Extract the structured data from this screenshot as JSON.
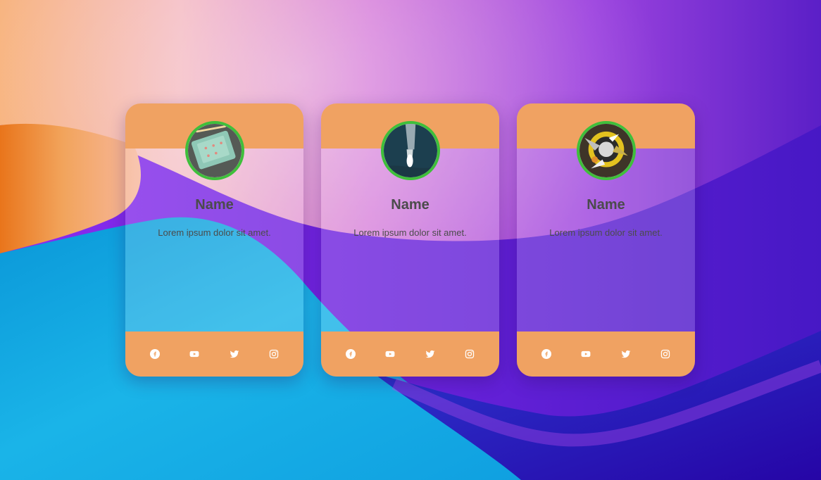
{
  "colors": {
    "card_accent": "#f0a262",
    "avatar_border": "#3fbf3b",
    "text": "#4b4b4b",
    "icon": "#ffffff"
  },
  "cards": [
    {
      "name": "Name",
      "description": "Lorem ipsum dolor sit amet.",
      "avatar_icon": "tablet-photo-icon",
      "social": [
        "facebook-icon",
        "youtube-icon",
        "twitter-icon",
        "instagram-icon"
      ]
    },
    {
      "name": "Name",
      "description": "Lorem ipsum dolor sit amet.",
      "avatar_icon": "boat-photo-icon",
      "social": [
        "facebook-icon",
        "youtube-icon",
        "twitter-icon",
        "instagram-icon"
      ]
    },
    {
      "name": "Name",
      "description": "Lorem ipsum dolor sit amet.",
      "avatar_icon": "abstract-3d-photo-icon",
      "social": [
        "facebook-icon",
        "youtube-icon",
        "twitter-icon",
        "instagram-icon"
      ]
    }
  ]
}
